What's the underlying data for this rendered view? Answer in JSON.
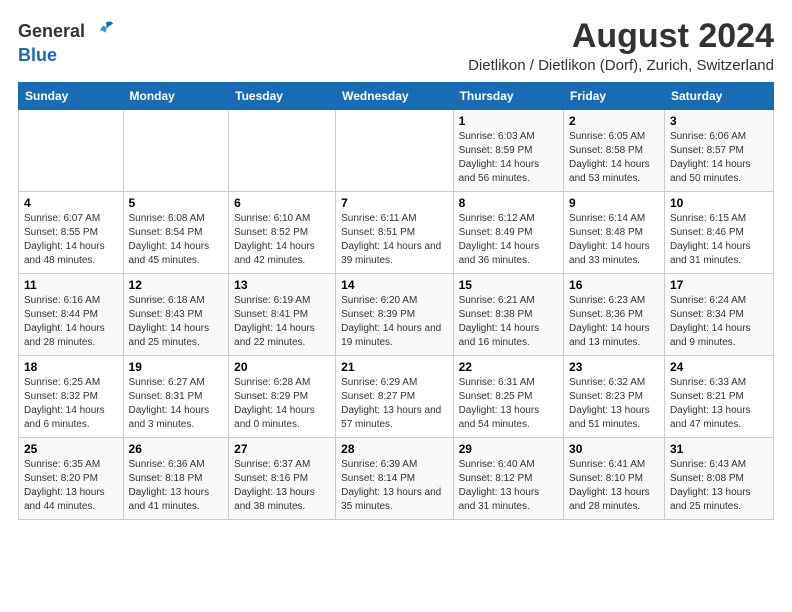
{
  "logo": {
    "text_general": "General",
    "text_blue": "Blue"
  },
  "title": "August 2024",
  "subtitle": "Dietlikon / Dietlikon (Dorf), Zurich, Switzerland",
  "header_color": "#1a6bb5",
  "days_of_week": [
    "Sunday",
    "Monday",
    "Tuesday",
    "Wednesday",
    "Thursday",
    "Friday",
    "Saturday"
  ],
  "weeks": [
    [
      {
        "day": "",
        "sunrise": "",
        "sunset": "",
        "daylight": ""
      },
      {
        "day": "",
        "sunrise": "",
        "sunset": "",
        "daylight": ""
      },
      {
        "day": "",
        "sunrise": "",
        "sunset": "",
        "daylight": ""
      },
      {
        "day": "",
        "sunrise": "",
        "sunset": "",
        "daylight": ""
      },
      {
        "day": "1",
        "sunrise": "Sunrise: 6:03 AM",
        "sunset": "Sunset: 8:59 PM",
        "daylight": "Daylight: 14 hours and 56 minutes."
      },
      {
        "day": "2",
        "sunrise": "Sunrise: 6:05 AM",
        "sunset": "Sunset: 8:58 PM",
        "daylight": "Daylight: 14 hours and 53 minutes."
      },
      {
        "day": "3",
        "sunrise": "Sunrise: 6:06 AM",
        "sunset": "Sunset: 8:57 PM",
        "daylight": "Daylight: 14 hours and 50 minutes."
      }
    ],
    [
      {
        "day": "4",
        "sunrise": "Sunrise: 6:07 AM",
        "sunset": "Sunset: 8:55 PM",
        "daylight": "Daylight: 14 hours and 48 minutes."
      },
      {
        "day": "5",
        "sunrise": "Sunrise: 6:08 AM",
        "sunset": "Sunset: 8:54 PM",
        "daylight": "Daylight: 14 hours and 45 minutes."
      },
      {
        "day": "6",
        "sunrise": "Sunrise: 6:10 AM",
        "sunset": "Sunset: 8:52 PM",
        "daylight": "Daylight: 14 hours and 42 minutes."
      },
      {
        "day": "7",
        "sunrise": "Sunrise: 6:11 AM",
        "sunset": "Sunset: 8:51 PM",
        "daylight": "Daylight: 14 hours and 39 minutes."
      },
      {
        "day": "8",
        "sunrise": "Sunrise: 6:12 AM",
        "sunset": "Sunset: 8:49 PM",
        "daylight": "Daylight: 14 hours and 36 minutes."
      },
      {
        "day": "9",
        "sunrise": "Sunrise: 6:14 AM",
        "sunset": "Sunset: 8:48 PM",
        "daylight": "Daylight: 14 hours and 33 minutes."
      },
      {
        "day": "10",
        "sunrise": "Sunrise: 6:15 AM",
        "sunset": "Sunset: 8:46 PM",
        "daylight": "Daylight: 14 hours and 31 minutes."
      }
    ],
    [
      {
        "day": "11",
        "sunrise": "Sunrise: 6:16 AM",
        "sunset": "Sunset: 8:44 PM",
        "daylight": "Daylight: 14 hours and 28 minutes."
      },
      {
        "day": "12",
        "sunrise": "Sunrise: 6:18 AM",
        "sunset": "Sunset: 8:43 PM",
        "daylight": "Daylight: 14 hours and 25 minutes."
      },
      {
        "day": "13",
        "sunrise": "Sunrise: 6:19 AM",
        "sunset": "Sunset: 8:41 PM",
        "daylight": "Daylight: 14 hours and 22 minutes."
      },
      {
        "day": "14",
        "sunrise": "Sunrise: 6:20 AM",
        "sunset": "Sunset: 8:39 PM",
        "daylight": "Daylight: 14 hours and 19 minutes."
      },
      {
        "day": "15",
        "sunrise": "Sunrise: 6:21 AM",
        "sunset": "Sunset: 8:38 PM",
        "daylight": "Daylight: 14 hours and 16 minutes."
      },
      {
        "day": "16",
        "sunrise": "Sunrise: 6:23 AM",
        "sunset": "Sunset: 8:36 PM",
        "daylight": "Daylight: 14 hours and 13 minutes."
      },
      {
        "day": "17",
        "sunrise": "Sunrise: 6:24 AM",
        "sunset": "Sunset: 8:34 PM",
        "daylight": "Daylight: 14 hours and 9 minutes."
      }
    ],
    [
      {
        "day": "18",
        "sunrise": "Sunrise: 6:25 AM",
        "sunset": "Sunset: 8:32 PM",
        "daylight": "Daylight: 14 hours and 6 minutes."
      },
      {
        "day": "19",
        "sunrise": "Sunrise: 6:27 AM",
        "sunset": "Sunset: 8:31 PM",
        "daylight": "Daylight: 14 hours and 3 minutes."
      },
      {
        "day": "20",
        "sunrise": "Sunrise: 6:28 AM",
        "sunset": "Sunset: 8:29 PM",
        "daylight": "Daylight: 14 hours and 0 minutes."
      },
      {
        "day": "21",
        "sunrise": "Sunrise: 6:29 AM",
        "sunset": "Sunset: 8:27 PM",
        "daylight": "Daylight: 13 hours and 57 minutes."
      },
      {
        "day": "22",
        "sunrise": "Sunrise: 6:31 AM",
        "sunset": "Sunset: 8:25 PM",
        "daylight": "Daylight: 13 hours and 54 minutes."
      },
      {
        "day": "23",
        "sunrise": "Sunrise: 6:32 AM",
        "sunset": "Sunset: 8:23 PM",
        "daylight": "Daylight: 13 hours and 51 minutes."
      },
      {
        "day": "24",
        "sunrise": "Sunrise: 6:33 AM",
        "sunset": "Sunset: 8:21 PM",
        "daylight": "Daylight: 13 hours and 47 minutes."
      }
    ],
    [
      {
        "day": "25",
        "sunrise": "Sunrise: 6:35 AM",
        "sunset": "Sunset: 8:20 PM",
        "daylight": "Daylight: 13 hours and 44 minutes."
      },
      {
        "day": "26",
        "sunrise": "Sunrise: 6:36 AM",
        "sunset": "Sunset: 8:18 PM",
        "daylight": "Daylight: 13 hours and 41 minutes."
      },
      {
        "day": "27",
        "sunrise": "Sunrise: 6:37 AM",
        "sunset": "Sunset: 8:16 PM",
        "daylight": "Daylight: 13 hours and 38 minutes."
      },
      {
        "day": "28",
        "sunrise": "Sunrise: 6:39 AM",
        "sunset": "Sunset: 8:14 PM",
        "daylight": "Daylight: 13 hours and 35 minutes."
      },
      {
        "day": "29",
        "sunrise": "Sunrise: 6:40 AM",
        "sunset": "Sunset: 8:12 PM",
        "daylight": "Daylight: 13 hours and 31 minutes."
      },
      {
        "day": "30",
        "sunrise": "Sunrise: 6:41 AM",
        "sunset": "Sunset: 8:10 PM",
        "daylight": "Daylight: 13 hours and 28 minutes."
      },
      {
        "day": "31",
        "sunrise": "Sunrise: 6:43 AM",
        "sunset": "Sunset: 8:08 PM",
        "daylight": "Daylight: 13 hours and 25 minutes."
      }
    ]
  ]
}
